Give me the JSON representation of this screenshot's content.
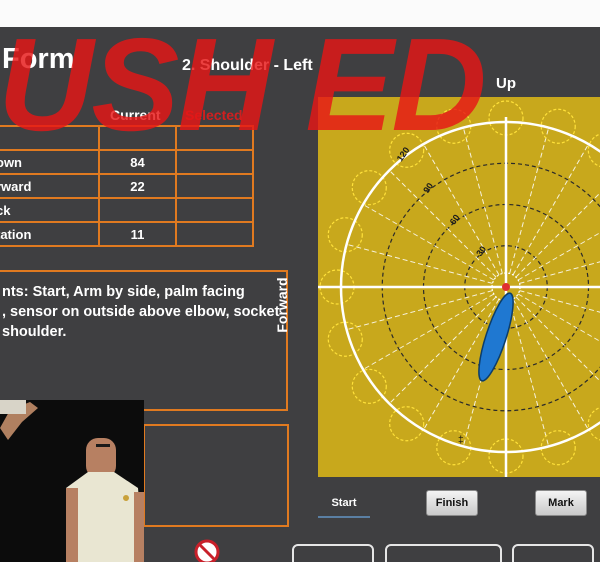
{
  "app": {
    "title": "Form",
    "subtitle": "2. Shoulder - Left",
    "watermark": "USH ED"
  },
  "table": {
    "headers": [
      "",
      "Current",
      "Selected"
    ],
    "rows": [
      {
        "label": "own",
        "current": "84",
        "selected": ""
      },
      {
        "label": "rward",
        "current": "22",
        "selected": ""
      },
      {
        "label": "ck",
        "current": "",
        "selected": ""
      },
      {
        "label": "tation",
        "current": "11",
        "selected": ""
      }
    ]
  },
  "instructions": {
    "line1": "nts: Start, Arm by side, palm facing",
    "line2": ", sensor on outside above elbow, socket",
    "line3": " shoulder."
  },
  "plot": {
    "axis_up": "Up",
    "axis_forward": "Forward",
    "ring_labels": [
      "30",
      "60",
      "90",
      "120"
    ],
    "colors": {
      "background": "#c8a81c",
      "ring": "#ffffff",
      "dashed_ring": "#2a2a2a",
      "yellow_dashed": "#ffe13a",
      "probe": "#1f78d1"
    }
  },
  "controls": {
    "start": "Start",
    "finish": "Finish",
    "mark": "Mark"
  },
  "icons": {
    "logo": "no-entry-logo-icon"
  }
}
